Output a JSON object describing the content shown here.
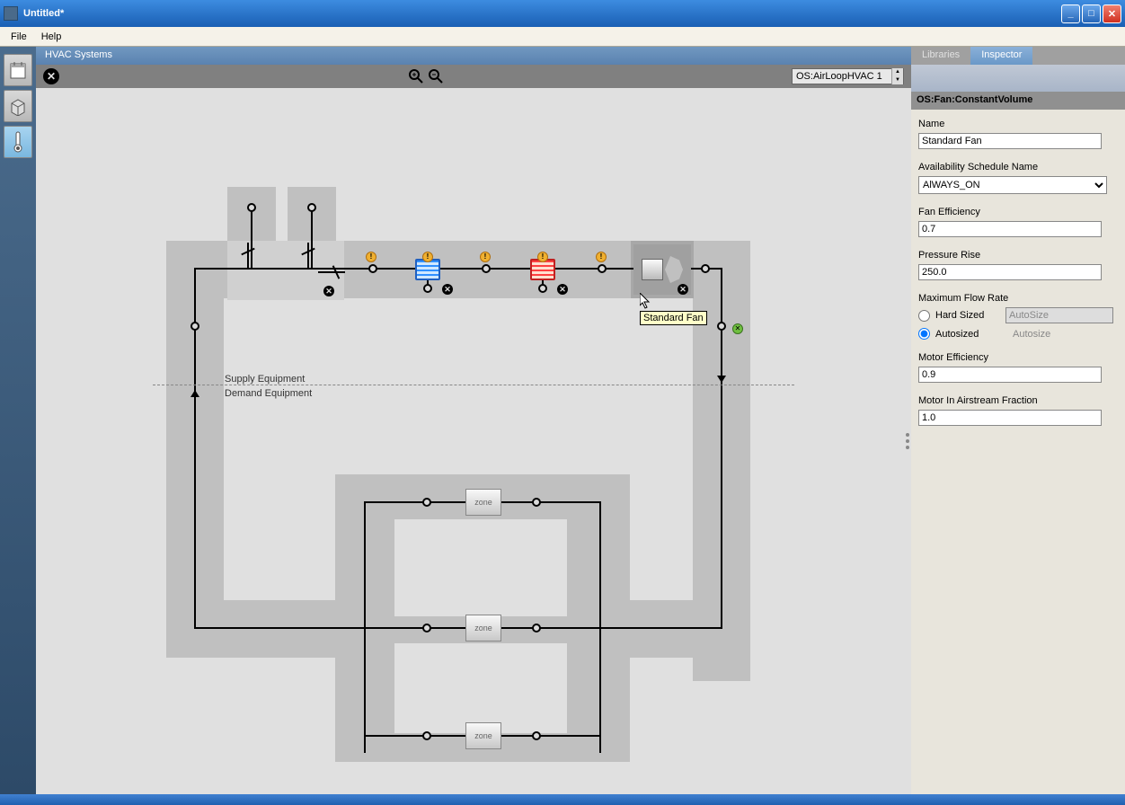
{
  "window": {
    "title": "Untitled*"
  },
  "menu": {
    "file": "File",
    "help": "Help"
  },
  "section_header": "HVAC Systems",
  "toolbar": {
    "loop_selector": "OS:AirLoopHVAC 1"
  },
  "rail": {
    "items": [
      "schedule",
      "geometry",
      "thermostat"
    ]
  },
  "diagram": {
    "supply_label": "Supply Equipment",
    "demand_label": "Demand Equipment",
    "zone_label": "zone",
    "tooltip": "Standard Fan"
  },
  "tabs": {
    "libraries": "Libraries",
    "inspector": "Inspector",
    "active": "inspector"
  },
  "inspector": {
    "type": "OS:Fan:ConstantVolume",
    "fields": {
      "name": {
        "label": "Name",
        "value": "Standard Fan"
      },
      "avail": {
        "label": "Availability Schedule Name",
        "value": "AlWAYS_ON"
      },
      "fan_eff": {
        "label": "Fan Efficiency",
        "value": "0.7"
      },
      "pressure": {
        "label": "Pressure Rise",
        "value": "250.0"
      },
      "max_flow": {
        "label": "Maximum Flow Rate",
        "hard_sized": "Hard Sized",
        "autosized": "Autosized",
        "hard_placeholder": "AutoSize",
        "auto_text": "Autosize",
        "selected": "autosized"
      },
      "motor_eff": {
        "label": "Motor Efficiency",
        "value": "0.9"
      },
      "motor_air": {
        "label": "Motor In Airstream Fraction",
        "value": "1.0"
      }
    }
  }
}
